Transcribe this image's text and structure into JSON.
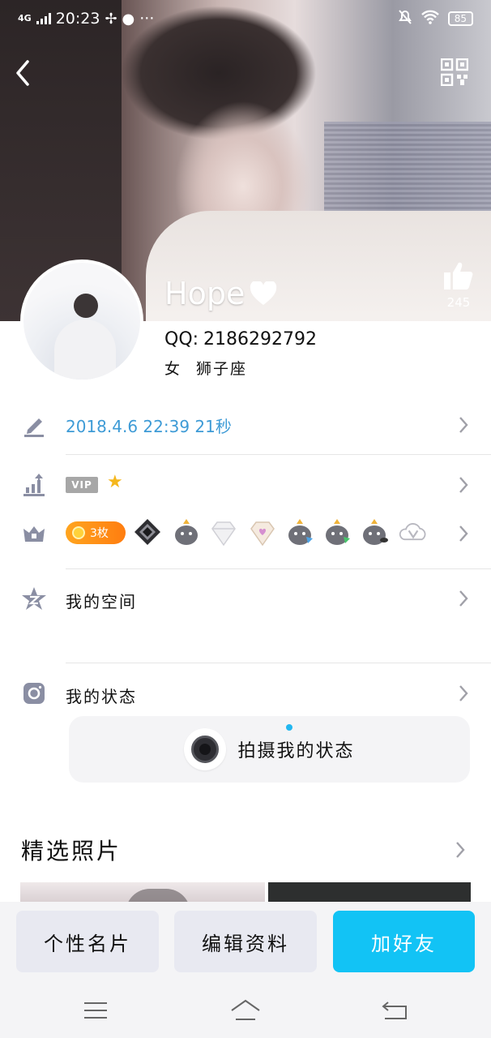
{
  "status_bar": {
    "network": "4G",
    "time": "20:23",
    "more": "···",
    "battery": "85"
  },
  "profile": {
    "nickname": "Hope",
    "likes": "245",
    "qq_label": "QQ:",
    "qq_number": "2186292792",
    "gender": "女",
    "zodiac": "狮子座"
  },
  "rows": {
    "signature_date": "2018.4.6 22:39 21秒",
    "vip_label": "VIP",
    "coin_count": "3枚",
    "space_label": "我的空间",
    "status_label": "我的状态",
    "capture_status": "拍摄我的状态"
  },
  "featured": {
    "title": "精选照片"
  },
  "actions": {
    "card": "个性名片",
    "edit": "编辑资料",
    "add_friend": "加好友"
  },
  "colors": {
    "accent": "#12c3f5",
    "link_blue": "#3e9bd6",
    "coin_orange": "#ff8e14",
    "icon_gray": "#8a8ea3"
  }
}
